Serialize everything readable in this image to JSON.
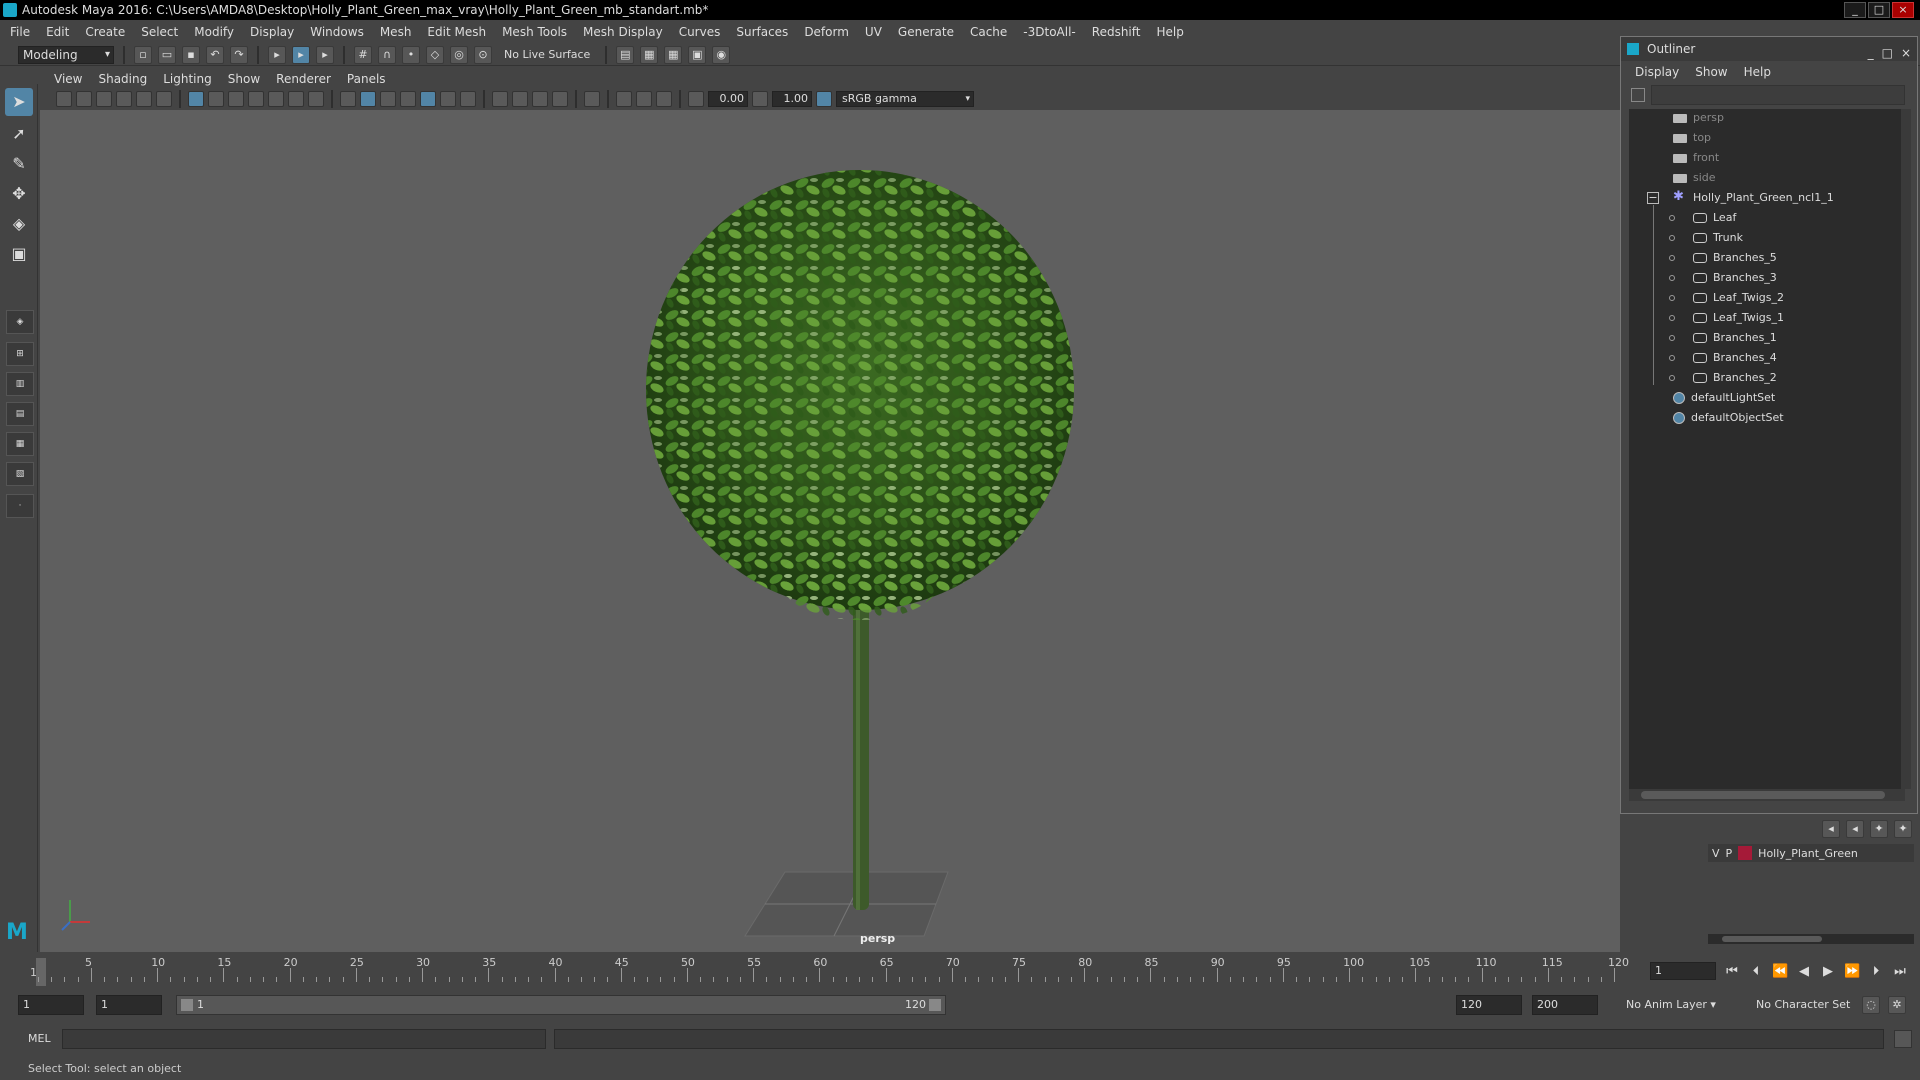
{
  "window": {
    "title": "Autodesk Maya 2016: C:\\Users\\AMDA8\\Desktop\\Holly_Plant_Green_max_vray\\Holly_Plant_Green_mb_standart.mb*",
    "min": "_",
    "max": "□",
    "close": "×"
  },
  "menubar": [
    "File",
    "Edit",
    "Create",
    "Select",
    "Modify",
    "Display",
    "Windows",
    "Mesh",
    "Edit Mesh",
    "Mesh Tools",
    "Mesh Display",
    "Curves",
    "Surfaces",
    "Deform",
    "UV",
    "Generate",
    "Cache",
    "-3DtoAll-",
    "Redshift",
    "Help"
  ],
  "status_line": {
    "mode": "Modeling",
    "live_surface": "No Live Surface"
  },
  "panel_menu": [
    "View",
    "Shading",
    "Lighting",
    "Show",
    "Renderer",
    "Panels"
  ],
  "panel_bar": {
    "exposure": "0.00",
    "gamma": "1.00",
    "color_space": "sRGB gamma"
  },
  "viewport": {
    "camera": "persp"
  },
  "outliner": {
    "title": "Outliner",
    "menu": [
      "Display",
      "Show",
      "Help"
    ],
    "items": [
      {
        "label": "persp",
        "type": "camera"
      },
      {
        "label": "top",
        "type": "camera"
      },
      {
        "label": "front",
        "type": "camera"
      },
      {
        "label": "side",
        "type": "camera"
      },
      {
        "label": "Holly_Plant_Green_ncl1_1",
        "type": "group"
      },
      {
        "label": "Leaf",
        "type": "mesh"
      },
      {
        "label": "Trunk",
        "type": "mesh"
      },
      {
        "label": "Branches_5",
        "type": "mesh"
      },
      {
        "label": "Branches_3",
        "type": "mesh"
      },
      {
        "label": "Leaf_Twigs_2",
        "type": "mesh"
      },
      {
        "label": "Leaf_Twigs_1",
        "type": "mesh"
      },
      {
        "label": "Branches_1",
        "type": "mesh"
      },
      {
        "label": "Branches_4",
        "type": "mesh"
      },
      {
        "label": "Branches_2",
        "type": "mesh"
      },
      {
        "label": "defaultLightSet",
        "type": "set"
      },
      {
        "label": "defaultObjectSet",
        "type": "set"
      }
    ]
  },
  "layers": {
    "v": "V",
    "p": "P",
    "name": "Holly_Plant_Green",
    "color": "#a51a38"
  },
  "timeline": {
    "ticks": [
      "5",
      "10",
      "15",
      "20",
      "25",
      "30",
      "35",
      "40",
      "45",
      "50",
      "55",
      "60",
      "65",
      "70",
      "75",
      "80",
      "85",
      "90",
      "95",
      "100",
      "105",
      "110",
      "115",
      "120"
    ],
    "current_frame": "1",
    "frame_field": "1"
  },
  "range": {
    "start": "1",
    "playback_start": "1",
    "slider_start": "1",
    "slider_end": "120",
    "playback_end": "120",
    "end": "200",
    "anim_layer": "No Anim Layer",
    "character_set": "No Character Set"
  },
  "cmdline": {
    "label": "MEL"
  },
  "helpline": {
    "text": "Select Tool: select an object"
  },
  "colors": {
    "accent": "#5285a6",
    "maya_teal": "#1aa7c9"
  }
}
